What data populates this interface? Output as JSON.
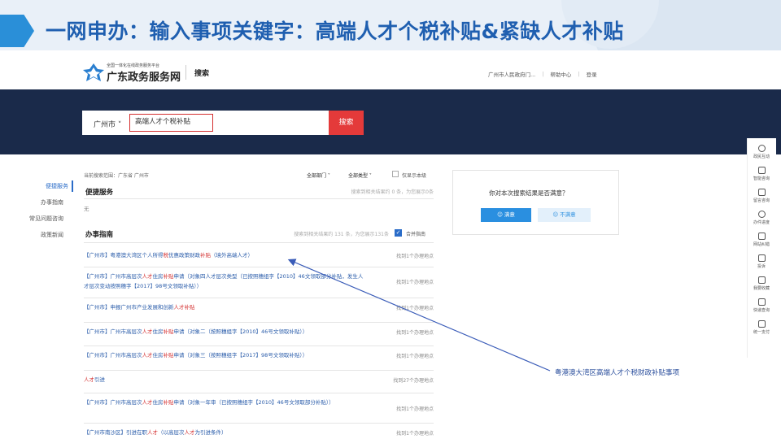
{
  "slide_title": "一网申办：输入事项关键字：高端人才个税补贴&紧缺人才补贴",
  "header": {
    "logo_small": "全国一体化在线政务服务平台",
    "logo_name": "广东政务服务网",
    "search_label": "搜索",
    "nav": [
      "广州市人民政府门...",
      "帮助中心",
      "登录"
    ]
  },
  "search": {
    "city": "广州市",
    "query": "高端人才个税补贴",
    "button": "搜索"
  },
  "left_nav": [
    "便捷服务",
    "办事指南",
    "常见问题咨询",
    "政策新闻"
  ],
  "filters": {
    "scope": "当前搜索范围：广东省 广州市",
    "dept": "全部部门",
    "type": "全部类型",
    "local_only": "仅显示本级"
  },
  "convenient": {
    "title": "便捷服务",
    "count": "搜索到相关结果约 0 条，为您展示0条",
    "none": "无"
  },
  "guide": {
    "title": "办事指南",
    "count": "搜索到相关结果约 131 条，为您展示131条",
    "merge_label": "合并指南",
    "rows": [
      {
        "pre": "【广州市】粤港澳大湾区个人所得",
        "h1": "税",
        "mid": "优惠政策财政",
        "h2": "补贴",
        "post": "（境外高端人才）",
        "count": "找到1个办理地点"
      },
      {
        "pre": "【广州市】广州市高层次",
        "h1": "人才",
        "mid": "住房",
        "h2": "补贴",
        "post": "申请（对象四人才层次类型（已按照穗组字【2010】46文领取部分补贴，发生人才层次变动按照穗字【2017】98号文领取补贴））",
        "count": "找到1个办理地点"
      },
      {
        "pre": "【广州市】申报广州市产业发展和创新",
        "h1": "人才",
        "mid": "",
        "h2": "补贴",
        "post": "",
        "count": "找到1个办理地点"
      },
      {
        "pre": "【广州市】广州市高层次",
        "h1": "人才",
        "mid": "住房",
        "h2": "补贴",
        "post": "申请（对象二（按照穗组字【2010】46号文领取补贴））",
        "count": "找到1个办理地点"
      },
      {
        "pre": "【广州市】广州市高层次",
        "h1": "人才",
        "mid": "住房",
        "h2": "补贴",
        "post": "申请（对象三（按照穗组字【2017】98号文领取补贴））",
        "count": "找到1个办理地点"
      },
      {
        "pre": "",
        "h1": "人才",
        "mid": "引进",
        "h2": "",
        "post": "",
        "count": "找到27个办理地点"
      },
      {
        "pre": "【广州市】广州市高层次",
        "h1": "人才",
        "mid": "住房",
        "h2": "补贴",
        "post": "申请（对象一年审（已按照穗组字【2010】46号文领取部分补贴））",
        "count": "找到1个办理地点"
      },
      {
        "pre": "【广州市南沙区】引进在职",
        "h1": "人才",
        "mid": "（以高层次",
        "h2": "人才",
        "post": "为引进条件）",
        "count": "找到1个办理地点"
      }
    ]
  },
  "satisfaction": {
    "question": "你对本次搜索结果是否满意？",
    "yes": "满意",
    "no": "不满意"
  },
  "right_sidebar": [
    "政民互动",
    "智能咨询",
    "留言咨询",
    "办件进度",
    "网站纠错",
    "投诉",
    "我要收藏",
    "快递查询",
    "统一支付"
  ],
  "annotation": "粤港澳大湾区高端人才个税财政补贴事项",
  "colors": {
    "accent_blue": "#2a6cc8",
    "highlight_red": "#d43030",
    "band_dark": "#1a2a4a",
    "search_red": "#e43a3a"
  }
}
